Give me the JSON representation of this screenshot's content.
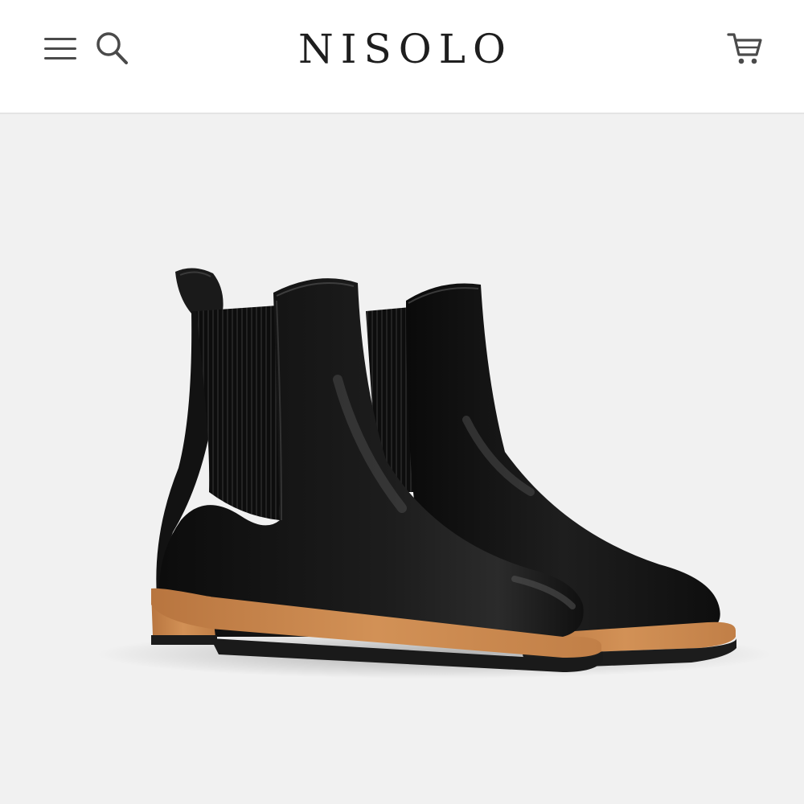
{
  "header": {
    "brand": "NISOLO",
    "menu_icon": "hamburger-menu-icon",
    "search_icon": "search-icon",
    "cart_icon": "shopping-cart-icon"
  },
  "hero": {
    "image": "black-leather-chelsea-boots-pair"
  },
  "colors": {
    "header_bg": "#ffffff",
    "page_bg": "#f1f1f1",
    "icon": "#4a4a4a",
    "boot_leather": "#151515",
    "sole_tan": "#c8874d"
  }
}
